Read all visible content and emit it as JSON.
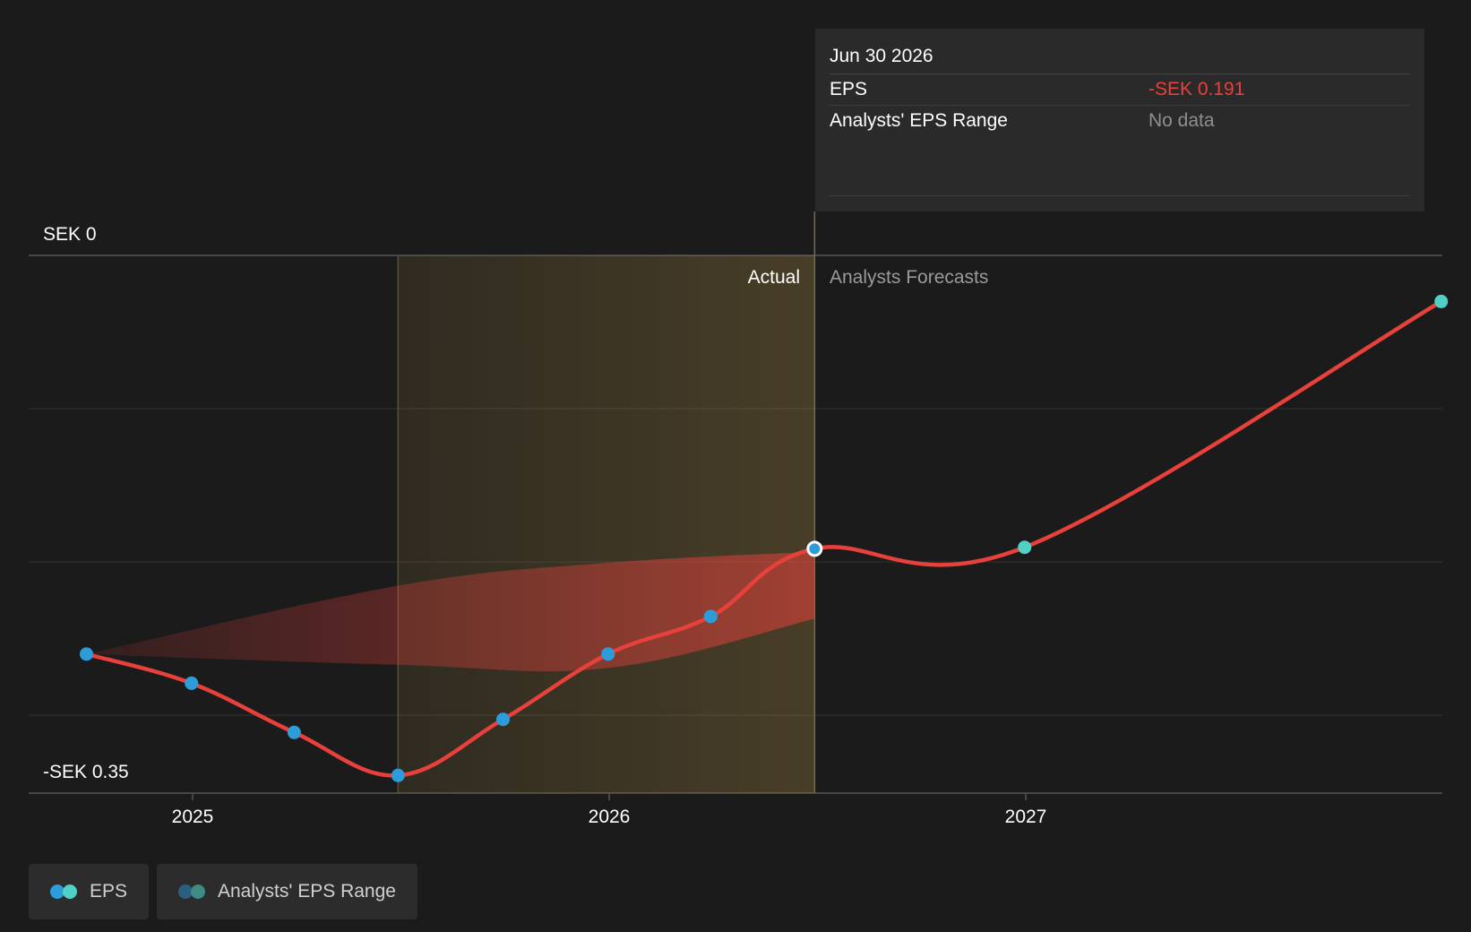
{
  "chart_data": {
    "type": "line",
    "currency_axis_labels": {
      "top": "SEK 0",
      "bottom": "-SEK 0.35"
    },
    "ylim": [
      -0.35,
      0
    ],
    "x_ticks": [
      "2025",
      "2026",
      "2027"
    ],
    "regions": {
      "actual_label": "Actual",
      "forecast_label": "Analysts Forecasts"
    },
    "series": [
      {
        "name": "EPS",
        "color": "#e8413c",
        "actual_color": "#2d9cdb",
        "forecast_color": "#4fd1c5",
        "points": [
          {
            "date": "2024-09-30",
            "value": -0.2595,
            "kind": "actual"
          },
          {
            "date": "2024-12-31",
            "value": -0.2785,
            "kind": "actual"
          },
          {
            "date": "2025-03-31",
            "value": -0.3105,
            "kind": "actual"
          },
          {
            "date": "2025-06-30",
            "value": -0.3385,
            "kind": "actual"
          },
          {
            "date": "2025-09-30",
            "value": -0.302,
            "kind": "actual"
          },
          {
            "date": "2025-12-31",
            "value": -0.2595,
            "kind": "actual"
          },
          {
            "date": "2026-03-31",
            "value": -0.235,
            "kind": "actual"
          },
          {
            "date": "2026-06-30",
            "value": -0.191,
            "kind": "actual",
            "highlight": true
          },
          {
            "date": "2026-12-31",
            "value": -0.19,
            "kind": "forecast"
          },
          {
            "date": "2027-12-31",
            "value": -0.03,
            "kind": "forecast"
          }
        ]
      }
    ],
    "range_band": {
      "name": "Analysts' EPS Range",
      "color": "#e8413c",
      "upper": [
        {
          "date": "2024-09-30",
          "value": -0.2595
        },
        {
          "date": "2025-06-30",
          "value": -0.215
        },
        {
          "date": "2026-01-01",
          "value": -0.2
        },
        {
          "date": "2026-06-30",
          "value": -0.193
        }
      ],
      "lower": [
        {
          "date": "2024-09-30",
          "value": -0.2595
        },
        {
          "date": "2025-06-30",
          "value": -0.2665
        },
        {
          "date": "2026-01-01",
          "value": -0.2685
        },
        {
          "date": "2026-06-30",
          "value": -0.2365
        }
      ]
    },
    "tooltip": {
      "date": "Jun 30 2026",
      "rows": [
        {
          "label": "EPS",
          "value": "-SEK 0.191"
        },
        {
          "label": "Analysts' EPS Range",
          "value": "No data"
        }
      ]
    },
    "legend": [
      {
        "label": "EPS",
        "colors": [
          "#2d9cdb",
          "#4fd1c5"
        ]
      },
      {
        "label": "Analysts' EPS Range",
        "colors": [
          "#2a5f80",
          "#3e8a84"
        ]
      }
    ]
  }
}
